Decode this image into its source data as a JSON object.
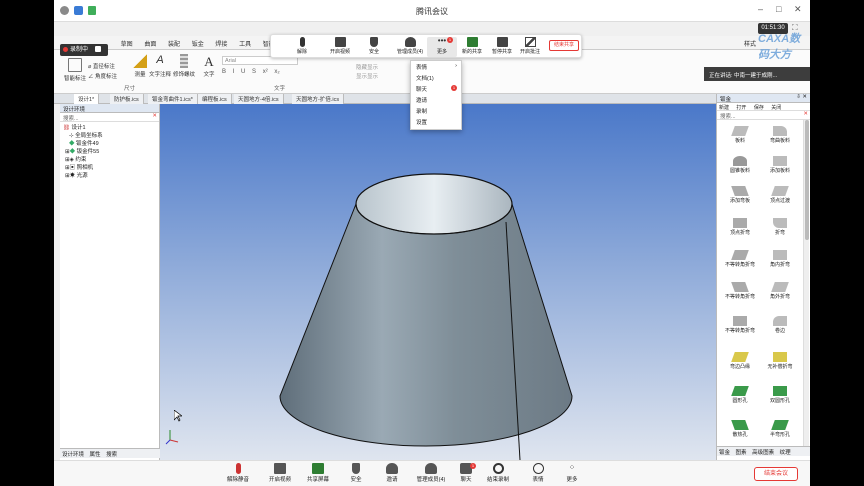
{
  "window": {
    "title": "腾讯会议",
    "clock": "01:51:30"
  },
  "recording": {
    "label": "录制中"
  },
  "ribbon_tabs": [
    "常用",
    "草图",
    "曲面",
    "装配",
    "钣金",
    "焊接",
    "工具",
    "智能"
  ],
  "ribbon": {
    "items": [
      "智能标注",
      "直径标注",
      "角度标注",
      "测量",
      "文字注释",
      "修饰螺纹",
      "文字"
    ],
    "group_label_1": "尺寸",
    "group_label_2": "文字",
    "font_placeholder": "Arial",
    "format_buttons": [
      "B",
      "I",
      "U",
      "S",
      "x²",
      "x₂"
    ],
    "partial_label_a": "隐藏显示",
    "partial_label_b": "显示显示",
    "style_label": "样式"
  },
  "doc_tabs": [
    "设计1*",
    "防护板.ics",
    "钣金弯曲件1.ics*",
    "编程板.ics",
    "天圆地方-4倍.ics",
    "天圆地方-扩倍.ics"
  ],
  "left_panel": {
    "title": "设计环境",
    "search": "搜索...",
    "tree": [
      "设计1",
      "全局坐标系",
      "钣金件49",
      "钣金件55",
      "约束",
      "照相机",
      "光源"
    ],
    "tabs": [
      "设计环境",
      "属性",
      "搜索"
    ]
  },
  "meeting_top": {
    "buttons": [
      "解除",
      "开启视频",
      "安全",
      "管理成员(4)",
      "更多",
      "新的共享",
      "暂停共享",
      "开启批注"
    ],
    "share_button": "结束共享",
    "more_badge": "1"
  },
  "more_menu": {
    "items": [
      "表情",
      "文档(1)",
      "聊天",
      "邀请",
      "录制",
      "设置"
    ],
    "badge": "1"
  },
  "speaker": {
    "text": "正在讲话: 中南一建于成刚..."
  },
  "right_panel": {
    "title": "钣金",
    "toolbar": [
      "新建",
      "打开",
      "保存",
      "关闭"
    ],
    "search": "搜索...",
    "items": [
      "板料",
      "弯曲板料",
      "圆锥板料",
      "添加板料",
      "添加弯板",
      "顶点过渡",
      "顶点折弯",
      "折弯",
      "不等转角折弯",
      "角内折弯",
      "不等转角折弯",
      "角外折弯",
      "不等转角折弯",
      "卷边",
      "弯边凸缘",
      "无补偿折弯",
      "圆形孔",
      "双圆形孔",
      "散热孔",
      "半弯形孔"
    ],
    "tabs": [
      "钣金",
      "图素",
      "高级图素",
      "纹理"
    ]
  },
  "meeting_bar": {
    "buttons": [
      "解除静音",
      "开启视频",
      "共享屏幕",
      "安全",
      "邀请",
      "管理成员(4)",
      "聊天",
      "结束录制",
      "表情",
      "更多"
    ],
    "chat_badge": "1",
    "end_button": "结束会议"
  },
  "watermark": "CAXA数码大方",
  "colors": {
    "accent_red": "#e53935",
    "viewport_top": "#4a78c9",
    "viewport_bottom": "#dfe5ef",
    "cone": "#8a9ca8"
  }
}
